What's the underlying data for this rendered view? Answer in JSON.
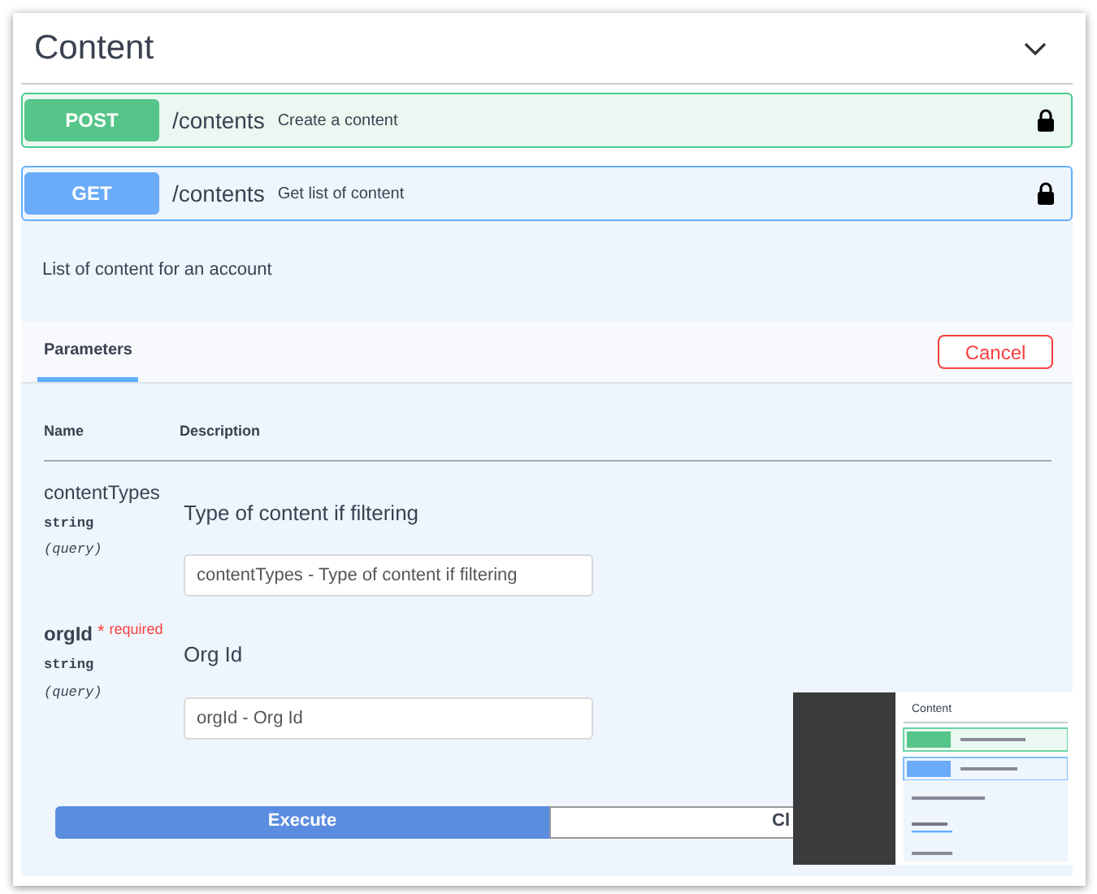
{
  "section": {
    "title": "Content",
    "expanded": true
  },
  "operations": [
    {
      "method": "POST",
      "path": "/contents",
      "summary": "Create a content"
    },
    {
      "method": "GET",
      "path": "/contents",
      "summary": "Get list of content"
    }
  ],
  "operation_detail": {
    "description": "List of content for an account",
    "tabs": [
      {
        "label": "Parameters",
        "selected": true
      }
    ],
    "cancel_button": "Cancel",
    "columns": [
      "Name",
      "Description"
    ],
    "parameters": [
      {
        "name": "contentTypes",
        "required": false,
        "type": "string",
        "location": "(query)",
        "description": "Type of content if filtering",
        "placeholder": "contentTypes - Type of content if filtering"
      },
      {
        "name": "orgId",
        "required": true,
        "required_mark": "*",
        "required_label": "required",
        "type": "string",
        "location": "(query)",
        "description": "Org Id",
        "placeholder": "orgId - Org Id"
      }
    ],
    "buttons": [
      {
        "label": "Execute",
        "kind": "primary"
      },
      {
        "label": "Cl",
        "kind": "secondary"
      }
    ]
  },
  "preview": {
    "title": "Content"
  }
}
